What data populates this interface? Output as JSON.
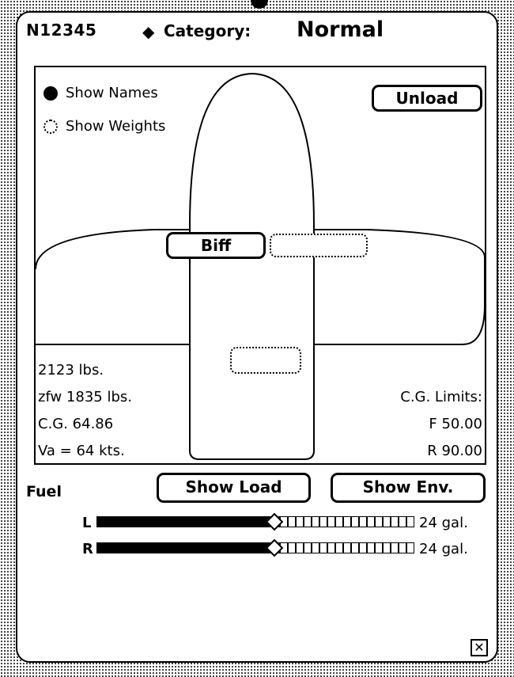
{
  "header": {
    "tail_number": "N12345",
    "category_marker": "◆",
    "category_label": "Category:",
    "category_value": "Normal"
  },
  "display_options": {
    "show_names_label": "Show Names",
    "show_names_selected": true,
    "show_weights_label": "Show Weights",
    "show_weights_selected": false
  },
  "buttons": {
    "unload": "Unload",
    "show_load": "Show Load",
    "show_env": "Show Env."
  },
  "seats": {
    "front_left": "Biff",
    "front_right": "",
    "rear": ""
  },
  "weights": {
    "gross": "2123 lbs.",
    "zfw": "zfw 1835 lbs.",
    "cg": "C.G. 64.86",
    "va": "Va = 64 kts."
  },
  "cg_limits": {
    "label": "C.G. Limits:",
    "forward": "F 50.00",
    "rear": "R 90.00"
  },
  "fuel": {
    "label": "Fuel",
    "tanks": [
      {
        "letter": "L",
        "capacity_text": "24 gal.",
        "fill_fraction": 0.56
      },
      {
        "letter": "R",
        "capacity_text": "24 gal.",
        "fill_fraction": 0.56
      }
    ]
  },
  "window": {
    "close_glyph": "✕"
  }
}
